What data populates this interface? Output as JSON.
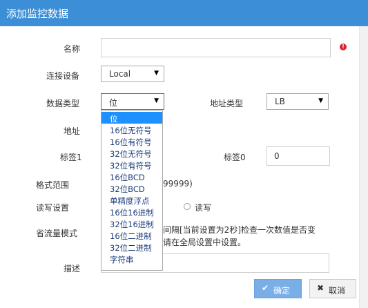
{
  "dialog": {
    "title": "添加监控数据"
  },
  "form": {
    "name_label": "名称",
    "name_value": "",
    "device_label": "连接设备",
    "device_value": "Local",
    "datatype_label": "数据类型",
    "datatype_value": "位",
    "addrtype_label": "地址类型",
    "addrtype_value": "LB",
    "address_label": "地址",
    "tag1_label": "标签1",
    "tag0_label": "标签0",
    "tag0_value": "0",
    "range_label": "格式范围",
    "range_text": "99999)",
    "rw_label": "读写设置",
    "rw_readwrite": "读写",
    "traffic_label": "省流量模式",
    "traffic_text_line1": "间隔[当前设置为2秒]检查一次数值是否变",
    "traffic_text_line2": "请在全局设置中设置。",
    "desc_label": "描述"
  },
  "datatype_options": [
    "位",
    "16位无符号",
    "16位有符号",
    "32位无符号",
    "32位有符号",
    "16位BCD",
    "32位BCD",
    "单精度浮点",
    "16位16进制",
    "32位16进制",
    "16位二进制",
    "32位二进制",
    "字符串"
  ],
  "buttons": {
    "ok": "确定",
    "cancel": "取消"
  },
  "colors": {
    "title_bg": "#3c8fd6",
    "selected_option": "#1e90ff",
    "ok_button": "#7aaee6",
    "error": "#d9232d"
  }
}
